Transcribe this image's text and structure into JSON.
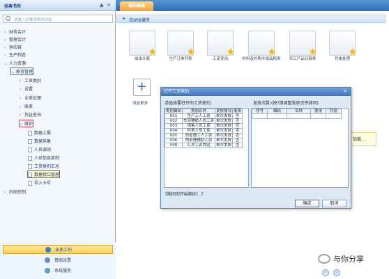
{
  "sidebar": {
    "title": "径典书所",
    "pin_icon": "pin-icon",
    "collapse_icon": "collapse-icon",
    "search_placeholder": "请输入您要搜索的功能",
    "tree": [
      {
        "label": "财务会计",
        "expanded": false
      },
      {
        "label": "管理会计",
        "expanded": false
      },
      {
        "label": "供应链",
        "expanded": false
      },
      {
        "label": "生产制造",
        "expanded": false
      },
      {
        "label": "人力资源",
        "expanded": true
      },
      {
        "label": "薪资管理",
        "expanded": true
      },
      {
        "label": "工资类别",
        "expanded": false
      },
      {
        "label": "设置",
        "expanded": false
      },
      {
        "label": "业务处理",
        "expanded": false
      },
      {
        "label": "账表",
        "expanded": false
      },
      {
        "label": "凭证查询",
        "expanded": false
      },
      {
        "label": "维护",
        "expanded": true
      },
      {
        "label": "数据上报"
      },
      {
        "label": "数据采集"
      },
      {
        "label": "人员调动"
      },
      {
        "label": "人员信息复制"
      },
      {
        "label": "工资类别汇总"
      },
      {
        "label": "数据接口管理"
      },
      {
        "label": "导入卡号"
      },
      {
        "label": "内部控制",
        "expanded": false
      }
    ],
    "bottom_nav": [
      {
        "label": "业务工作",
        "icon": "business-icon"
      },
      {
        "label": "基础设置",
        "icon": "settings-icon"
      },
      {
        "label": "系统服务",
        "icon": "service-icon"
      }
    ]
  },
  "main": {
    "tab_label": "我的桌面",
    "section_title": "自动收藏夹",
    "functions": [
      {
        "label": "成本计算"
      },
      {
        "label": "生产订单列表"
      },
      {
        "label": "工资变动"
      },
      {
        "label": "材料及外购半成品耗用"
      },
      {
        "label": "完工产品日报表"
      },
      {
        "label": "月末处理"
      }
    ],
    "add_label": "添加更多",
    "loading_text": "加载..."
  },
  "dialog": {
    "title": "打开工资类别",
    "close_icon": "close-icon",
    "left_label": "请选择要打开的工资类别:",
    "right_label": "发放次数:(按?键调整发放次序排列)",
    "left_headers": [
      "类别编码",
      "类别名称",
      "发放情况",
      "使用"
    ],
    "left_rows": [
      [
        "001",
        "生产工人工资",
        "单次发放",
        "否"
      ],
      [
        "002",
        "车间辅助人员工资",
        "单次发放",
        "否"
      ],
      [
        "003",
        "销售人员工资",
        "单次发放",
        "否"
      ],
      [
        "004",
        "科室人员工资",
        "单次发放",
        "否"
      ],
      [
        "005",
        "热处理工人工资",
        "单次发放",
        "否"
      ],
      [
        "006",
        "热处理辅助工资",
        "单次发放",
        "否"
      ],
      [
        "998",
        "汇总工资类别",
        "单次发放",
        "否"
      ]
    ],
    "right_headers": [
      "序号",
      "编码",
      "名称",
      "使用",
      "月结"
    ],
    "status": "7期间的开始期间：7",
    "ok_label": "确定",
    "cancel_label": "取消"
  },
  "watermark": {
    "text": "与你分享",
    "icon": "wechat-icon"
  }
}
